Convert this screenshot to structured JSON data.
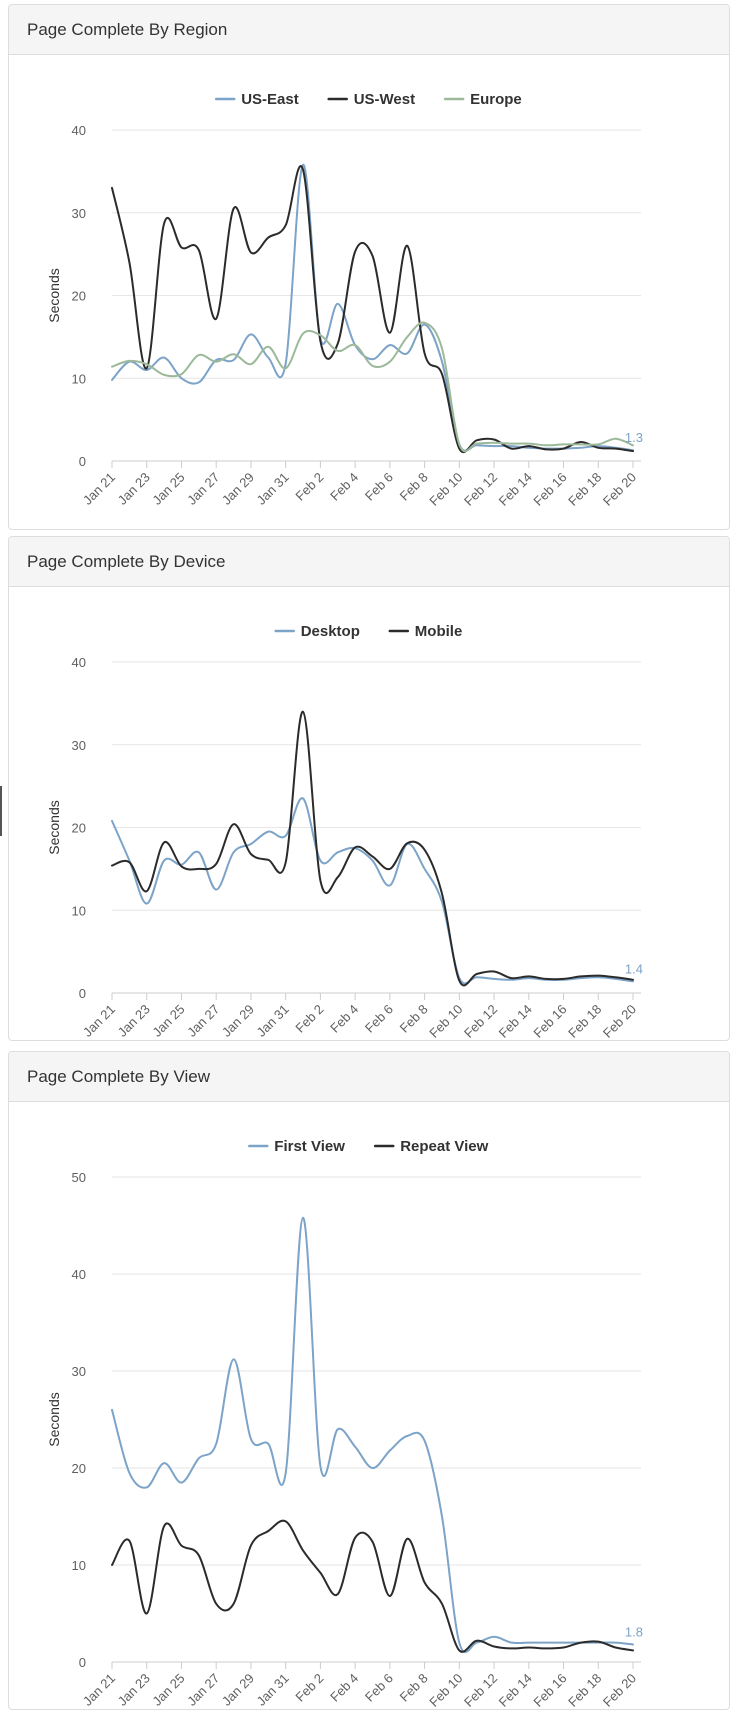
{
  "colors": {
    "blue": "#7ca3c8",
    "black": "#2b2b2b",
    "green": "#9cb99a"
  },
  "chart_data": [
    {
      "type": "line",
      "title": "Page Complete By Region",
      "ylabel": "Seconds",
      "ylim": [
        0,
        40
      ],
      "yticks": [
        0,
        10,
        20,
        30,
        40
      ],
      "xtick_labels": [
        "Jan 21",
        "Jan 23",
        "Jan 25",
        "Jan 27",
        "Jan 29",
        "Jan 31",
        "Feb 2",
        "Feb 4",
        "Feb 6",
        "Feb 8",
        "Feb 10",
        "Feb 12",
        "Feb 14",
        "Feb 16",
        "Feb 18",
        "Feb 20"
      ],
      "legend": "top-center",
      "grid": true,
      "end_label": "1.3",
      "series": [
        {
          "name": "US-East",
          "color": "#7ca3c8",
          "values": [
            9.8,
            12,
            11,
            12.5,
            10,
            9.5,
            12.2,
            12.2,
            15.3,
            12.5,
            11.8,
            35.8,
            14.8,
            19,
            14,
            12.3,
            14,
            13,
            16.5,
            12,
            2,
            1.9,
            1.8,
            1.8,
            1.6,
            1.5,
            1.5,
            1.6,
            1.8,
            1.6,
            1.3
          ]
        },
        {
          "name": "US-West",
          "color": "#2b2b2b",
          "values": [
            33,
            24,
            11.2,
            28.7,
            25.8,
            25.5,
            17.2,
            30.5,
            25.2,
            27,
            28.5,
            35.2,
            14.5,
            14.2,
            25.3,
            24.8,
            15.5,
            26,
            13,
            10.5,
            1.5,
            2.5,
            2.6,
            1.5,
            1.8,
            1.4,
            1.5,
            2.3,
            1.6,
            1.5,
            1.2
          ]
        },
        {
          "name": "Europe",
          "color": "#9cb99a",
          "values": [
            11.4,
            12.1,
            11.7,
            10.4,
            10.5,
            12.8,
            12,
            12.9,
            11.7,
            13.8,
            11.2,
            15.4,
            15.2,
            13.3,
            14,
            11.5,
            12,
            15,
            16.7,
            13.6,
            2,
            2.1,
            2.2,
            2.1,
            2.1,
            1.9,
            2,
            2,
            2,
            2.7,
            1.9
          ]
        }
      ]
    },
    {
      "type": "line",
      "title": "Page Complete By Device",
      "ylabel": "Seconds",
      "ylim": [
        0,
        40
      ],
      "yticks": [
        0,
        10,
        20,
        30,
        40
      ],
      "xtick_labels": [
        "Jan 21",
        "Jan 23",
        "Jan 25",
        "Jan 27",
        "Jan 29",
        "Jan 31",
        "Feb 2",
        "Feb 4",
        "Feb 6",
        "Feb 8",
        "Feb 10",
        "Feb 12",
        "Feb 14",
        "Feb 16",
        "Feb 18",
        "Feb 20"
      ],
      "legend": "top-center",
      "grid": true,
      "end_label": "1.4",
      "series": [
        {
          "name": "Desktop",
          "color": "#7ca3c8",
          "values": [
            20.8,
            16,
            10.8,
            16,
            15.5,
            17,
            12.5,
            17,
            18,
            19.5,
            19,
            23.5,
            16,
            17,
            17.5,
            16,
            13,
            18,
            15,
            11,
            1.8,
            1.9,
            1.7,
            1.6,
            1.8,
            1.6,
            1.6,
            1.8,
            1.9,
            1.7,
            1.4
          ]
        },
        {
          "name": "Mobile",
          "color": "#2b2b2b",
          "values": [
            15.4,
            15.8,
            12.3,
            18.2,
            15.3,
            15,
            15.6,
            20.4,
            16.8,
            16.1,
            15.8,
            34,
            13.6,
            14,
            17.6,
            16.5,
            15,
            18.1,
            17.3,
            12,
            1.5,
            2.3,
            2.6,
            1.8,
            2,
            1.7,
            1.7,
            2,
            2.1,
            1.9,
            1.6
          ]
        }
      ]
    },
    {
      "type": "line",
      "title": "Page Complete By View",
      "ylabel": "Seconds",
      "ylim": [
        0,
        50
      ],
      "yticks": [
        0,
        10,
        20,
        30,
        40,
        50
      ],
      "xtick_labels": [
        "Jan 21",
        "Jan 23",
        "Jan 25",
        "Jan 27",
        "Jan 29",
        "Jan 31",
        "Feb 2",
        "Feb 4",
        "Feb 6",
        "Feb 8",
        "Feb 10",
        "Feb 12",
        "Feb 14",
        "Feb 16",
        "Feb 18",
        "Feb 20"
      ],
      "legend": "top-center",
      "grid": true,
      "end_label": "1.8",
      "series": [
        {
          "name": "First View",
          "color": "#7ca3c8",
          "values": [
            26,
            19.5,
            18,
            20.5,
            18.5,
            21,
            22.5,
            31.2,
            23,
            22.5,
            19.5,
            45.8,
            20.2,
            24,
            22.2,
            20,
            21.8,
            23.3,
            22.8,
            15,
            2,
            2,
            2.6,
            2,
            2,
            2,
            2,
            2,
            2,
            2,
            1.8
          ]
        },
        {
          "name": "Repeat View",
          "color": "#2b2b2b",
          "values": [
            10,
            12.5,
            5,
            14,
            12,
            11,
            6,
            6,
            12,
            13.5,
            14.5,
            11.5,
            9.2,
            7,
            12.8,
            12.4,
            6.8,
            12.7,
            8.2,
            6,
            1.2,
            2.2,
            1.6,
            1.4,
            1.5,
            1.4,
            1.5,
            2,
            2.1,
            1.5,
            1.2
          ]
        }
      ]
    }
  ]
}
